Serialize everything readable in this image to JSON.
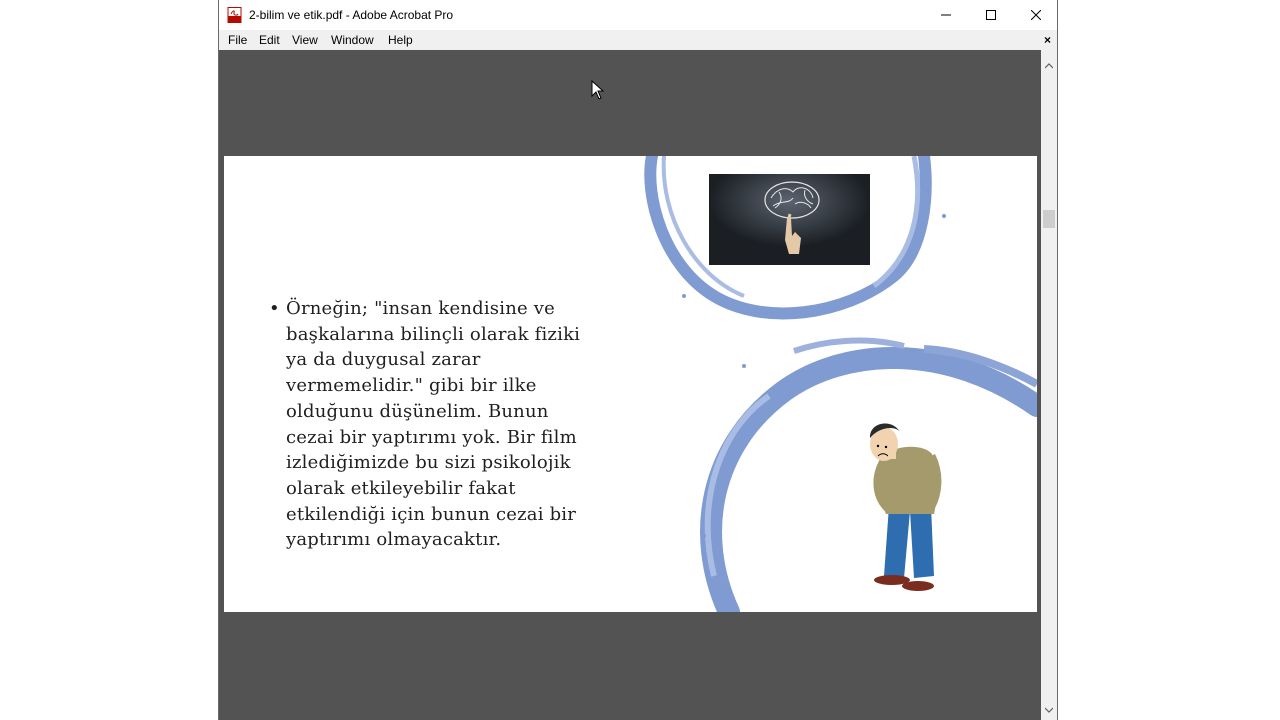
{
  "window": {
    "title": "2-bilim ve etik.pdf - Adobe Acrobat Pro",
    "controls": {
      "minimize": "minimize",
      "maximize": "maximize",
      "close": "close"
    }
  },
  "menu": {
    "items": [
      "File",
      "Edit",
      "View",
      "Window",
      "Help"
    ],
    "close_glyph": "×"
  },
  "slide": {
    "bullet": "•",
    "paragraph_lines": [
      "Örneğin; \"insan kendisine ve",
      "başkalarına bilinçli olarak fiziki",
      "ya da duygusal zarar",
      "vermemelidir.\" gibi bir ilke",
      "olduğunu düşünelim. Bunun",
      "cezai bir yaptırımı yok. Bir film",
      "izlediğimizde bu sizi psikolojik",
      "olarak etkileyebilir fakat",
      "etkilendiği için bunun cezai bir",
      "yaptırımı olmayacaktır."
    ]
  },
  "colors": {
    "viewer_bg": "#535353",
    "menubar_bg": "#f0f0f0",
    "ring_blue": "#7f9bd1",
    "text": "#1f1f1f"
  },
  "icons": {
    "app": "pdf-icon",
    "scroll_up": "chevron-up-icon",
    "scroll_down": "chevron-down-icon",
    "cursor": "mouse-pointer-icon"
  }
}
